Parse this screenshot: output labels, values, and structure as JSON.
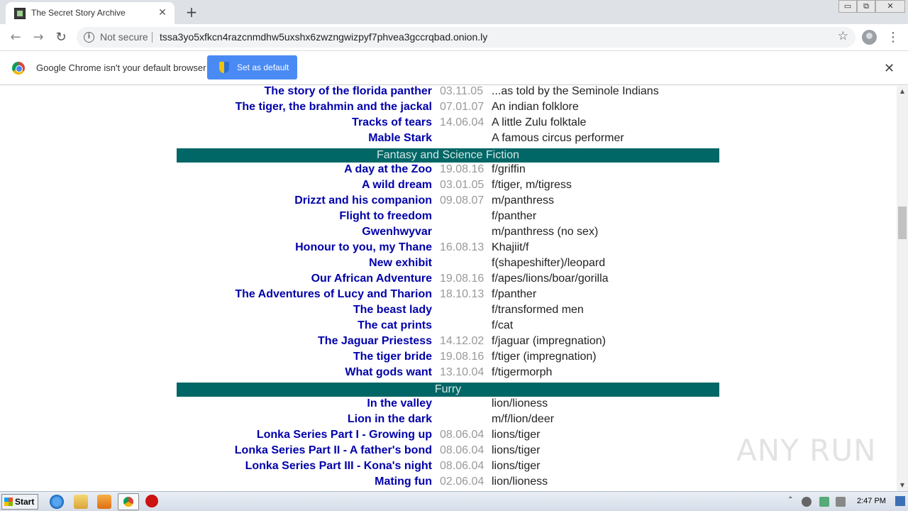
{
  "browser": {
    "tab_title": "The Secret Story Archive",
    "tab_close": "✕",
    "new_tab": "+",
    "back": "←",
    "forward": "→",
    "reload": "↻",
    "security_icon": "i",
    "security_label": "Not secure",
    "url": "tssa3yo5xfkcn4razcnmdhw5uxshx6zwzngwizpyf7phvea3gccrqbad.onion.ly",
    "bookmark_star": "☆",
    "menu": "⋮"
  },
  "window_controls": {
    "minimize": "▭",
    "restore": "⧉",
    "close": "✕"
  },
  "infobar": {
    "message": "Google Chrome isn't your default browser",
    "button": "Set as default",
    "close": "✕"
  },
  "rows_top": [
    {
      "name": "The story of the florida panther",
      "date": "03.11.05",
      "desc": "...as told by the Seminole Indians"
    },
    {
      "name": "The tiger, the brahmin and the jackal",
      "date": "07.01.07",
      "desc": "An indian folklore"
    },
    {
      "name": "Tracks of tears",
      "date": "14.06.04",
      "desc": "A little Zulu folktale"
    },
    {
      "name": "Mable Stark",
      "date": "",
      "desc": "A famous circus performer"
    }
  ],
  "category_fantasy": "Fantasy and Science Fiction",
  "rows_fantasy": [
    {
      "name": "A day at the Zoo",
      "date": "19.08.16",
      "desc": "f/griffin"
    },
    {
      "name": "A wild dream",
      "date": "03.01.05",
      "desc": "f/tiger, m/tigress"
    },
    {
      "name": "Drizzt and his companion",
      "date": "09.08.07",
      "desc": "m/panthress"
    },
    {
      "name": "Flight to freedom",
      "date": "",
      "desc": "f/panther"
    },
    {
      "name": "Gwenhwyvar",
      "date": "",
      "desc": "m/panthress (no sex)"
    },
    {
      "name": "Honour to you, my Thane",
      "date": "16.08.13",
      "desc": "Khajiit/f"
    },
    {
      "name": "New exhibit",
      "date": "",
      "desc": "f(shapeshifter)/leopard"
    },
    {
      "name": "Our African Adventure",
      "date": "19.08.16",
      "desc": "f/apes/lions/boar/gorilla"
    },
    {
      "name": "The Adventures of Lucy and Tharion",
      "date": "18.10.13",
      "desc": "f/panther"
    },
    {
      "name": "The beast lady",
      "date": "",
      "desc": "f/transformed men"
    },
    {
      "name": "The cat prints",
      "date": "",
      "desc": "f/cat"
    },
    {
      "name": "The Jaguar Priestess",
      "date": "14.12.02",
      "desc": "f/jaguar (impregnation)"
    },
    {
      "name": "The tiger bride",
      "date": "19.08.16",
      "desc": "f/tiger (impregnation)"
    },
    {
      "name": "What gods want",
      "date": "13.10.04",
      "desc": "f/tigermorph"
    }
  ],
  "category_furry": "Furry",
  "rows_furry": [
    {
      "name": "In the valley",
      "date": "",
      "desc": "lion/lioness"
    },
    {
      "name": "Lion in the dark",
      "date": "",
      "desc": "m/f/lion/deer"
    },
    {
      "name": "Lonka Series Part I - Growing up",
      "date": "08.06.04",
      "desc": "lions/tiger"
    },
    {
      "name": "Lonka Series Part II - A father's bond",
      "date": "08.06.04",
      "desc": "lions/tiger"
    },
    {
      "name": "Lonka Series Part III - Kona's night",
      "date": "08.06.04",
      "desc": "lions/tiger"
    },
    {
      "name": "Mating fun",
      "date": "02.06.04",
      "desc": "lion/lioness"
    }
  ],
  "watermark": "ANY RUN",
  "taskbar": {
    "start": "Start",
    "tray_arrow": "⌃",
    "clock": "2:47 PM"
  },
  "colors": {
    "link": "#0000aa",
    "category_bg": "#006666",
    "date": "#999999"
  }
}
